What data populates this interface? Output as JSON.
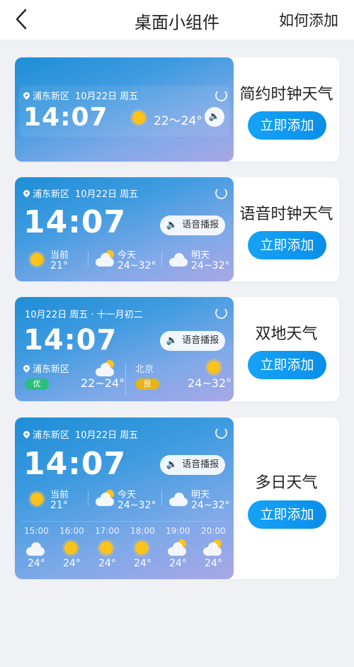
{
  "header": {
    "title": "桌面小组件",
    "action": "如何添加"
  },
  "add_label": "立即添加",
  "voice_label": "语音播报",
  "colors": {
    "add_button": "#0a8ee8",
    "quality_good": "#2bbf7a",
    "quality_fair": "#e8b21c"
  },
  "cards": [
    {
      "name": "简约时钟天气",
      "location": "浦东新区",
      "date": "10月22日",
      "weekday": "周五",
      "time": "14:07",
      "temp_range": "22～24°"
    },
    {
      "name": "语音时钟天气",
      "location": "浦东新区",
      "date": "10月22日",
      "weekday": "周五",
      "time": "14:07",
      "now_label": "当前",
      "now_temp": "21°",
      "today_label": "今天",
      "today_temp": "24~32°",
      "tomorrow_label": "明天",
      "tomorrow_temp": "24~32°"
    },
    {
      "name": "双地天气",
      "date_line": "10月22日 周五 · 十一月初二",
      "time": "14:07",
      "loc1": "浦东新区",
      "loc1_quality": "优",
      "loc1_temp": "22~24°",
      "loc2": "北京",
      "loc2_quality": "良",
      "loc2_temp": "24~32°"
    },
    {
      "name": "多日天气",
      "location": "浦东新区",
      "date": "10月22日",
      "weekday": "周五",
      "time": "14:07",
      "now_label": "当前",
      "now_temp": "21°",
      "today_label": "今天",
      "today_temp": "24~32°",
      "tomorrow_label": "明天",
      "tomorrow_temp": "24~32°",
      "hourly": [
        {
          "time": "15:00",
          "icon": "cloud-icon",
          "temp": "24°"
        },
        {
          "time": "16:00",
          "icon": "sun-icon",
          "temp": "24°"
        },
        {
          "time": "17:00",
          "icon": "sun-icon",
          "temp": "24°"
        },
        {
          "time": "18:00",
          "icon": "sun-icon",
          "temp": "24°"
        },
        {
          "time": "19:00",
          "icon": "partly-cloudy-icon",
          "temp": "24°"
        },
        {
          "time": "20:00",
          "icon": "partly-cloudy-icon",
          "temp": "24°"
        }
      ]
    }
  ]
}
